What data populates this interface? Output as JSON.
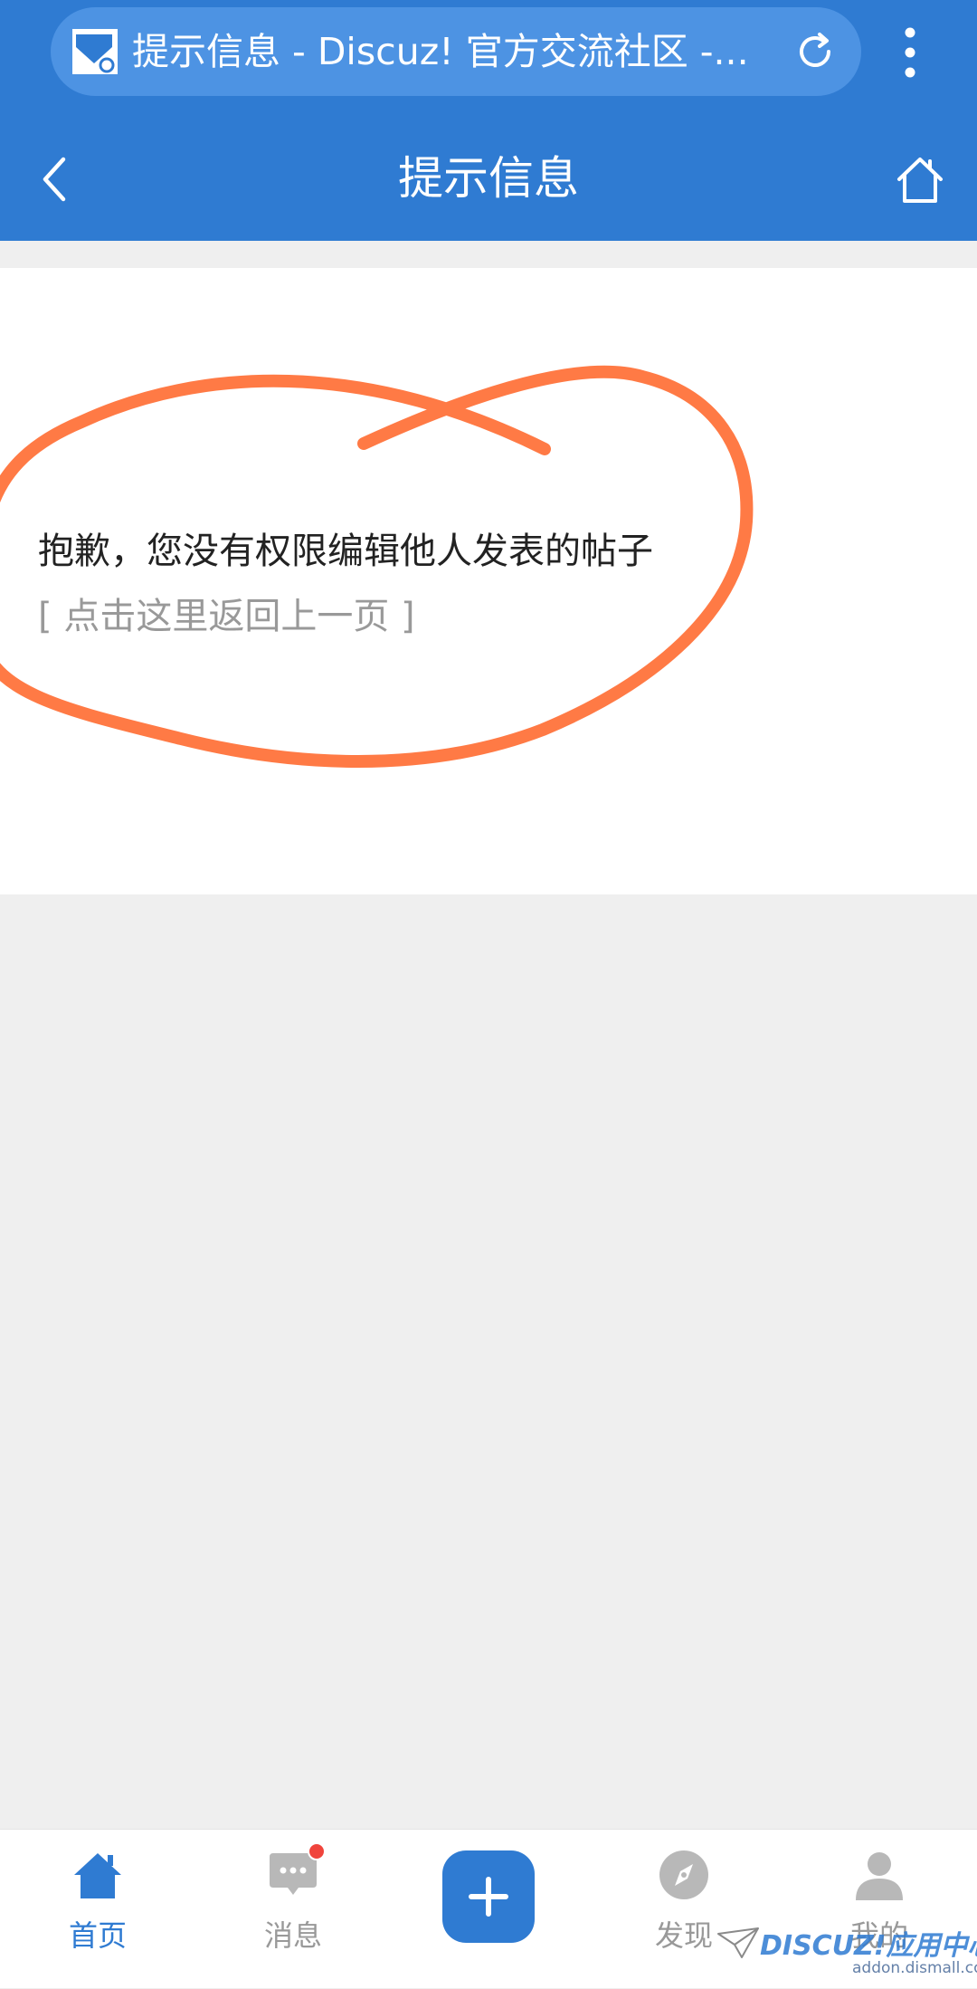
{
  "browser": {
    "tab_title": "提示信息 - Discuz! 官方交流社区 -...",
    "icons": {
      "favicon": "discuz-favicon-icon",
      "reload": "reload-icon",
      "menu": "more-vertical-icon"
    }
  },
  "header": {
    "title": "提示信息",
    "icons": {
      "back": "chevron-left-icon",
      "home": "home-icon"
    }
  },
  "message": {
    "text": "抱歉，您没有权限编辑他人发表的帖子",
    "back_link_open": "[",
    "back_link_label": "点击这里返回上一页",
    "back_link_close": "]"
  },
  "bottom_nav": {
    "items": [
      {
        "label": "首页",
        "icon": "home-icon",
        "active": true
      },
      {
        "label": "消息",
        "icon": "chat-bubble-icon",
        "badge": true
      },
      {
        "label": "",
        "icon": "plus-icon"
      },
      {
        "label": "发现",
        "icon": "compass-icon"
      },
      {
        "label": "我的",
        "icon": "user-icon"
      }
    ]
  },
  "watermark": {
    "logo": "DISCUZ!应用中心",
    "url": "addon.dismall.com"
  },
  "colors": {
    "primary": "#2f7bd2",
    "annotation": "#ff7a45",
    "badge": "#f0443c",
    "inactive": "#999999"
  }
}
